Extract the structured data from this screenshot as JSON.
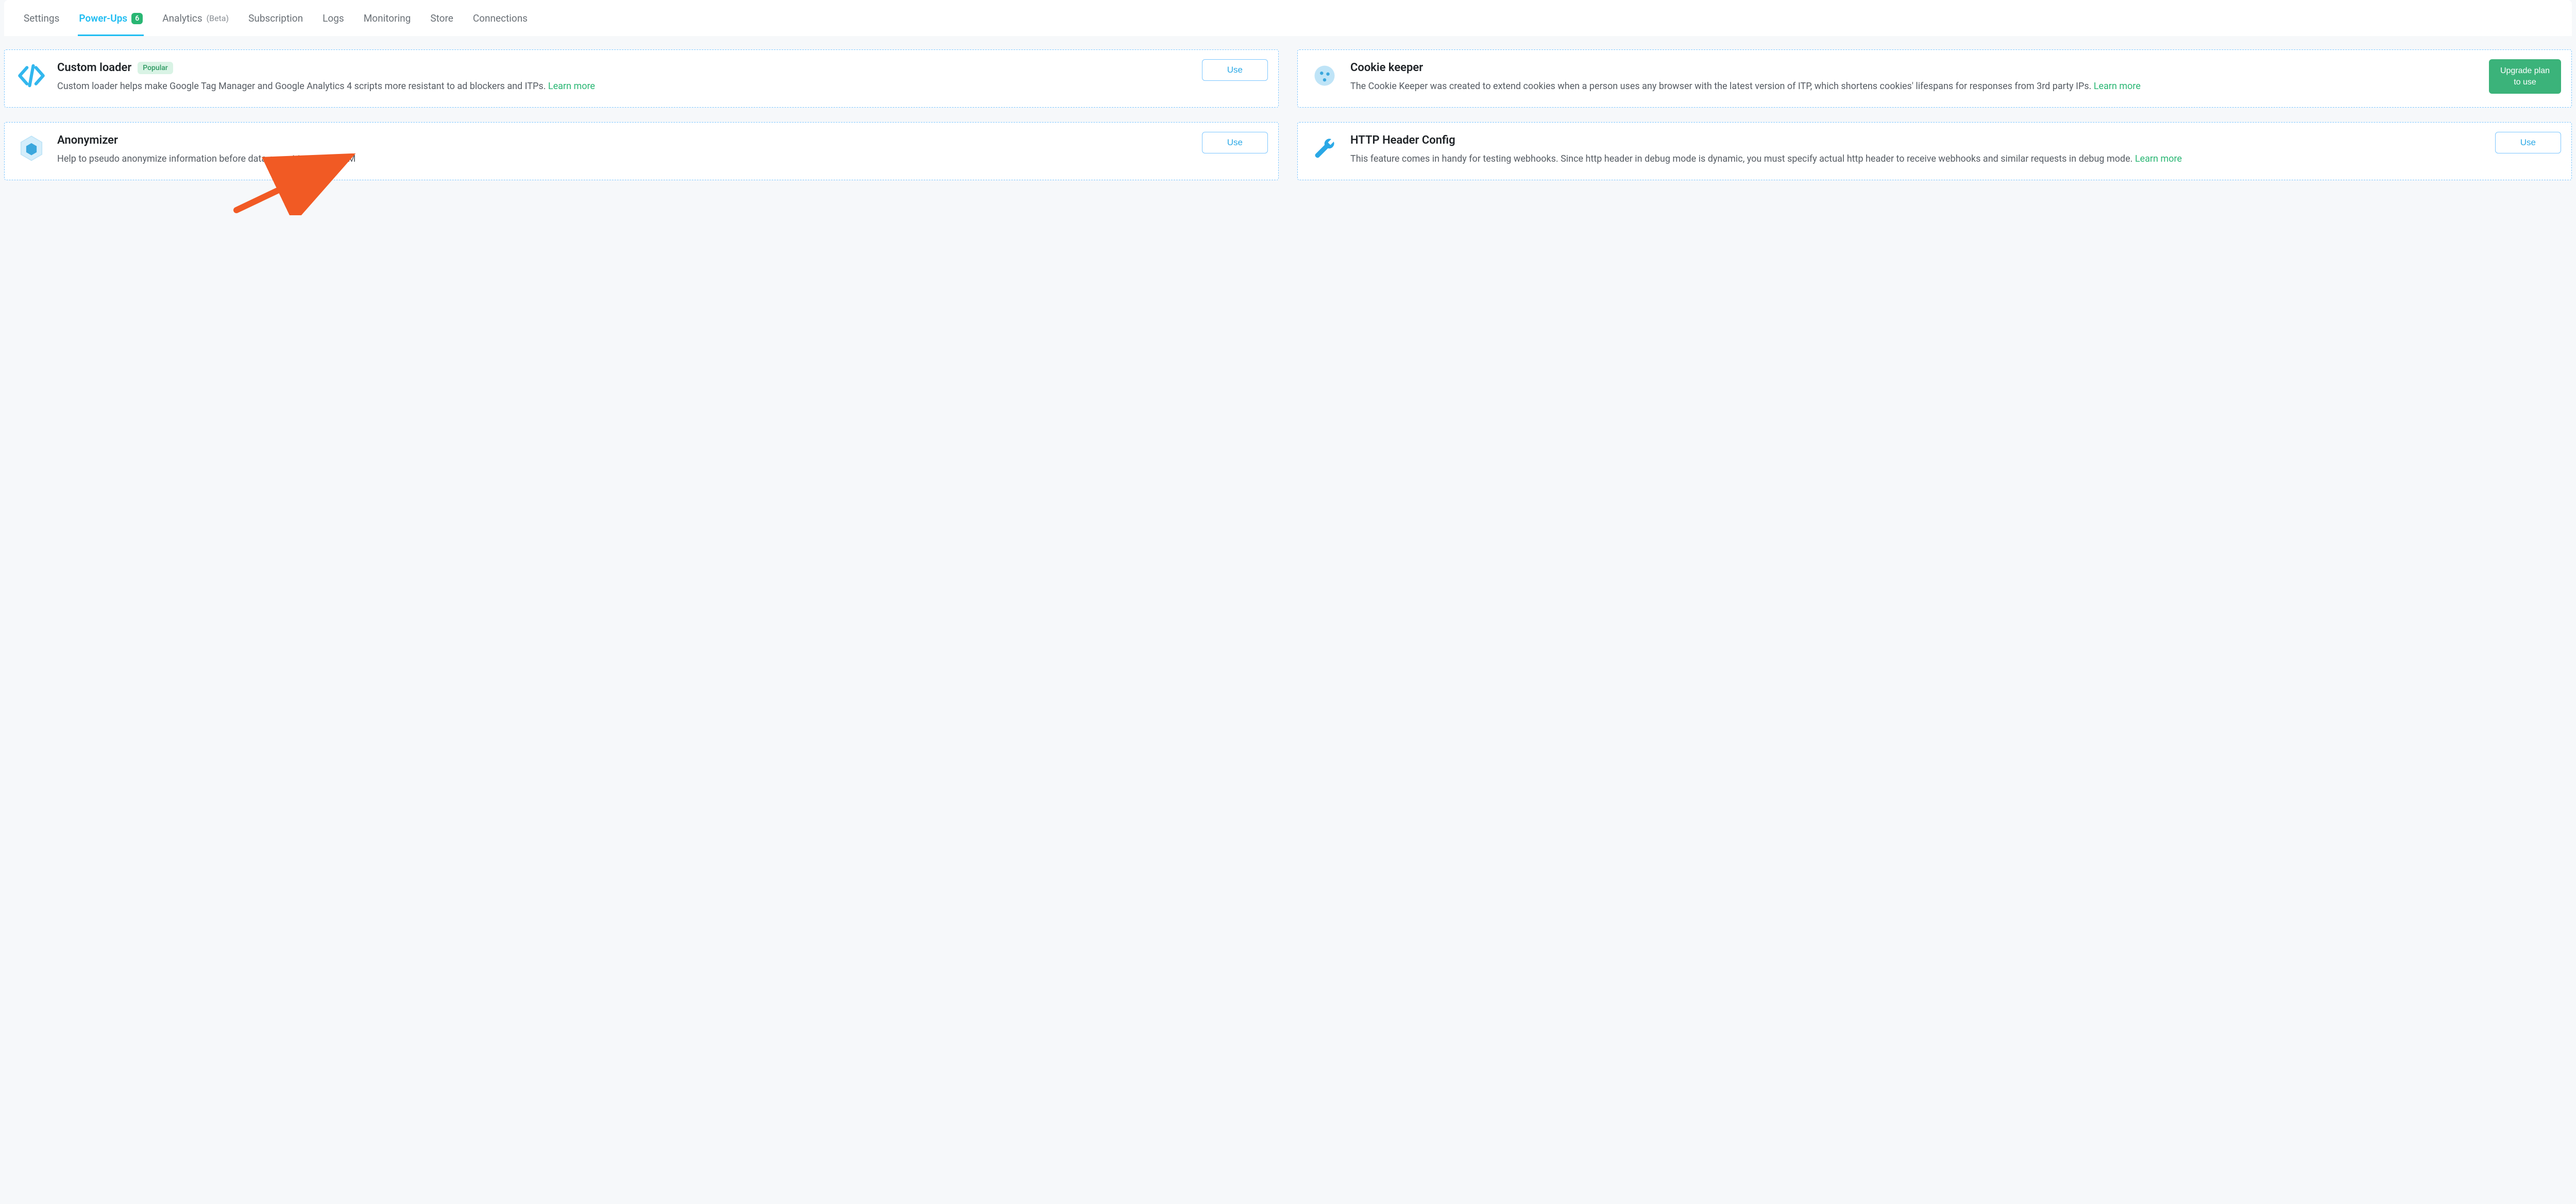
{
  "tabs": {
    "settings": "Settings",
    "powerups": "Power-Ups",
    "powerups_count": "6",
    "analytics": "Analytics",
    "analytics_sub": "(Beta)",
    "subscription": "Subscription",
    "logs": "Logs",
    "monitoring": "Monitoring",
    "store": "Store",
    "connections": "Connections"
  },
  "buttons": {
    "use": "Use",
    "upgrade": "Upgrade plan to use",
    "learn_more": "Learn more"
  },
  "badges": {
    "popular": "Popular"
  },
  "cards": {
    "custom_loader": {
      "title": "Custom loader",
      "desc": "Custom loader helps make Google Tag Manager and Google Analytics 4 scripts more resistant to ad blockers and ITPs. "
    },
    "cookie_keeper": {
      "title": "Cookie keeper",
      "desc": "The Cookie Keeper was created to extend cookies when a person uses any browser with the latest version of ITP, which shortens cookies' lifespans for responses from 3rd party IPs. "
    },
    "anonymizer": {
      "title": "Anonymizer",
      "desc": "Help to pseudo anonymize information before data export to server GTM"
    },
    "http_header": {
      "title": "HTTP Header Config",
      "desc": "This feature comes in handy for testing webhooks. Since http header in debug mode is dynamic, you must specify actual http header to receive webhooks and similar requests in debug mode. "
    }
  }
}
